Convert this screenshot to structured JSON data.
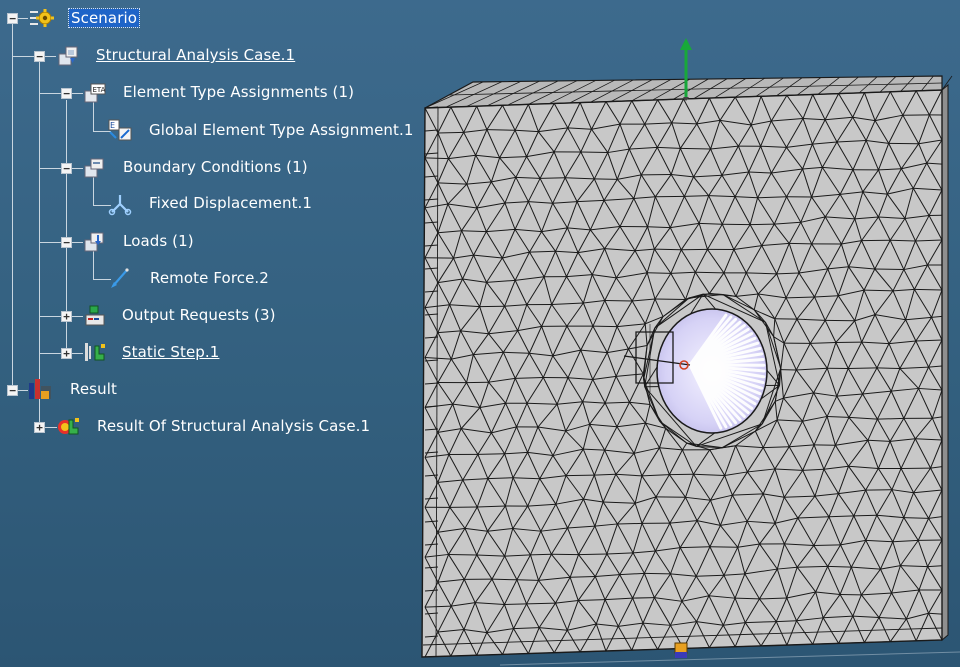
{
  "tree": {
    "items": [
      {
        "label": "Scenario"
      },
      {
        "label": "Structural Analysis Case.1"
      },
      {
        "label": "Element Type Assignments (1)"
      },
      {
        "label": "Global Element Type Assignment.1"
      },
      {
        "label": "Boundary Conditions (1)"
      },
      {
        "label": "Fixed Displacement.1"
      },
      {
        "label": "Loads (1)"
      },
      {
        "label": "Remote Force.2"
      },
      {
        "label": "Output Requests (3)"
      },
      {
        "label": "Static Step.1"
      },
      {
        "label": "Result"
      },
      {
        "label": "Result Of Structural Analysis Case.1"
      }
    ]
  },
  "icons": [
    "scenario-gear-icon",
    "analysis-case-icon",
    "element-type-icon",
    "global-element-type-icon",
    "boundary-conditions-icon",
    "fixed-displacement-icon",
    "loads-icon",
    "remote-force-icon",
    "output-requests-icon",
    "static-step-icon",
    "result-icon",
    "result-case-icon"
  ],
  "colors": {
    "background": "#3a678a",
    "selection": "#1e64c8",
    "mesh_face": "#c8c8c8",
    "mesh_edge": "#1a1a1a",
    "axis_arrow": "#18a83a"
  }
}
